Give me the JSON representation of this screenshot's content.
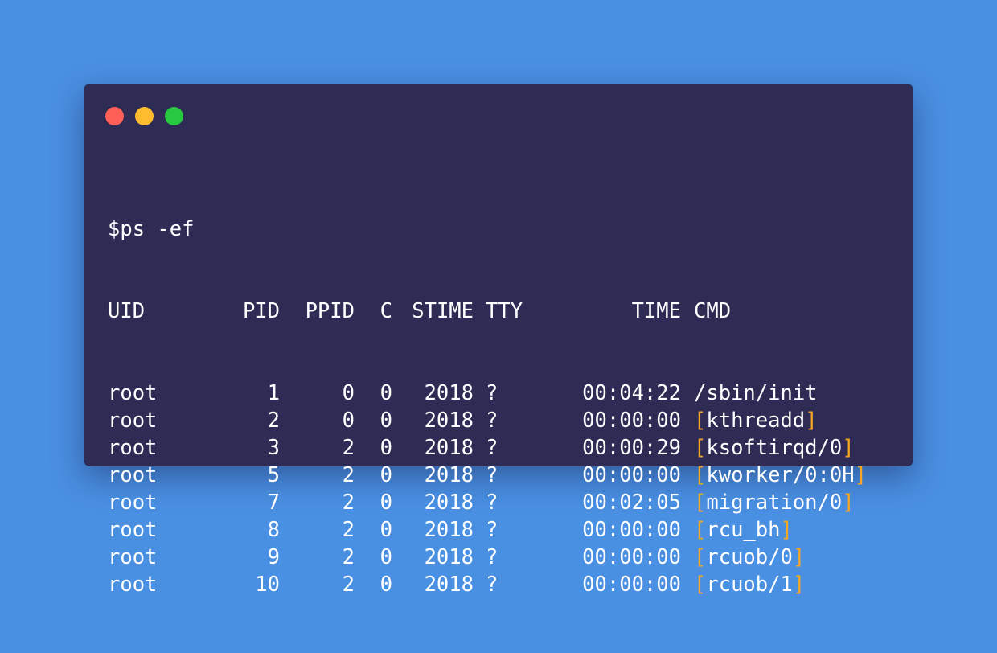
{
  "window": {
    "controls": [
      "close",
      "minimize",
      "maximize"
    ],
    "colors": {
      "background": "#4a90e2",
      "terminal": "#2e2b55",
      "text": "#ffffff",
      "bracket": "#f5a623",
      "close": "#fe5f57",
      "minimize": "#febc2e",
      "maximize": "#28c840"
    }
  },
  "command": "$ps -ef",
  "header": {
    "uid": "UID",
    "pid": "PID",
    "ppid": "PPID",
    "c": "C",
    "stime": "STIME",
    "tty": "TTY",
    "time": "TIME",
    "cmd": "CMD"
  },
  "rows": [
    {
      "uid": "root",
      "pid": "1",
      "ppid": "0",
      "c": "0",
      "stime": "2018",
      "tty": "?",
      "time": "00:04:22",
      "cmd": "/sbin/init",
      "kernel": false
    },
    {
      "uid": "root",
      "pid": "2",
      "ppid": "0",
      "c": "0",
      "stime": "2018",
      "tty": "?",
      "time": "00:00:00",
      "cmd": "kthreadd",
      "kernel": true
    },
    {
      "uid": "root",
      "pid": "3",
      "ppid": "2",
      "c": "0",
      "stime": "2018",
      "tty": "?",
      "time": "00:00:29",
      "cmd": "ksoftirqd/0",
      "kernel": true
    },
    {
      "uid": "root",
      "pid": "5",
      "ppid": "2",
      "c": "0",
      "stime": "2018",
      "tty": "?",
      "time": "00:00:00",
      "cmd": "kworker/0:0H",
      "kernel": true
    },
    {
      "uid": "root",
      "pid": "7",
      "ppid": "2",
      "c": "0",
      "stime": "2018",
      "tty": "?",
      "time": "00:02:05",
      "cmd": "migration/0",
      "kernel": true
    },
    {
      "uid": "root",
      "pid": "8",
      "ppid": "2",
      "c": "0",
      "stime": "2018",
      "tty": "?",
      "time": "00:00:00",
      "cmd": "rcu_bh",
      "kernel": true
    },
    {
      "uid": "root",
      "pid": "9",
      "ppid": "2",
      "c": "0",
      "stime": "2018",
      "tty": "?",
      "time": "00:00:00",
      "cmd": "rcuob/0",
      "kernel": true
    },
    {
      "uid": "root",
      "pid": "10",
      "ppid": "2",
      "c": "0",
      "stime": "2018",
      "tty": "?",
      "time": "00:00:00",
      "cmd": "rcuob/1",
      "kernel": true
    }
  ]
}
